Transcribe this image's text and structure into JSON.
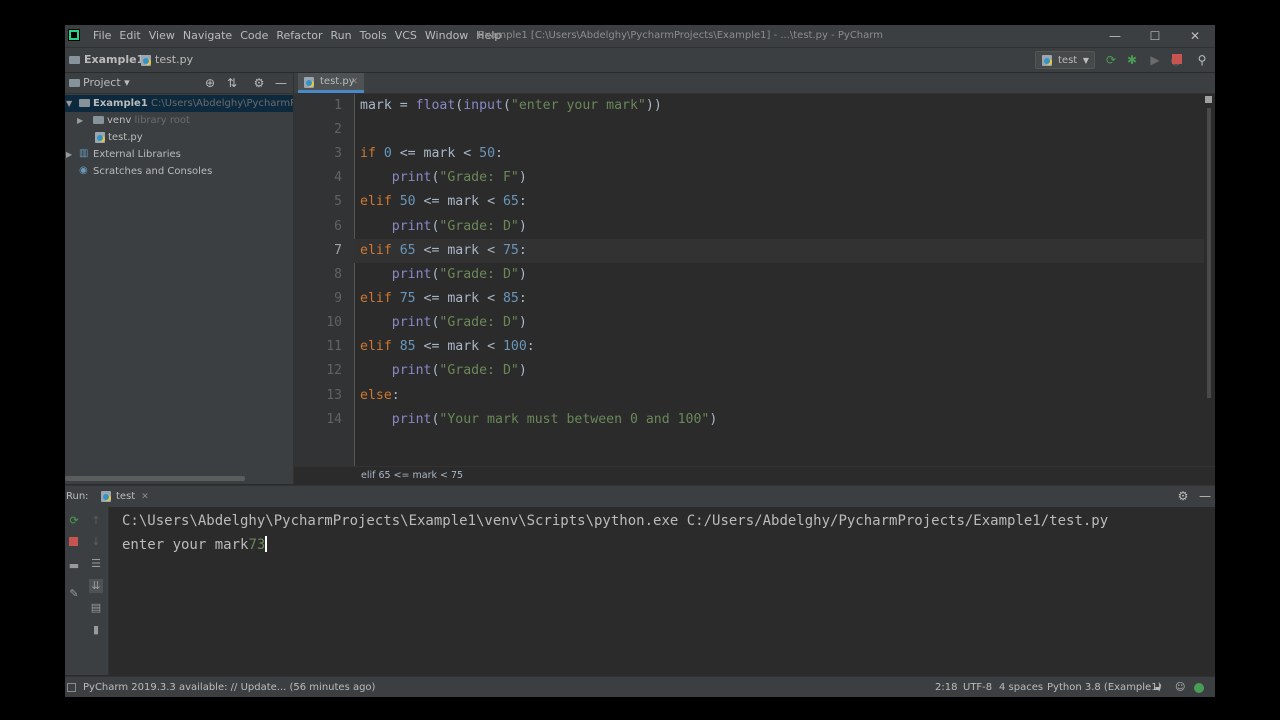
{
  "menu": [
    "File",
    "Edit",
    "View",
    "Navigate",
    "Code",
    "Refactor",
    "Run",
    "Tools",
    "VCS",
    "Window",
    "Help"
  ],
  "window_title": "Example1 [C:\\Users\\Abdelghy\\PycharmProjects\\Example1] - ...\\test.py - PyCharm",
  "window_controls": {
    "minimize": "—",
    "maximize": "☐",
    "close": "✕"
  },
  "navbar": {
    "project": "Example1",
    "file": "test.py",
    "run_config": "test"
  },
  "project_panel": {
    "title": "Project",
    "tree": [
      {
        "label": "Example1",
        "hint": "C:\\Users\\Abdelghy\\PycharmProjects\\Example1"
      },
      {
        "label": "venv",
        "hint": "library root"
      },
      {
        "label": "test.py",
        "hint": ""
      },
      {
        "label": "External Libraries",
        "hint": ""
      },
      {
        "label": "Scratches and Consoles",
        "hint": ""
      }
    ]
  },
  "editor": {
    "tab": "test.py",
    "current_line": 7,
    "line_numbers": [
      "1",
      "2",
      "3",
      "4",
      "5",
      "6",
      "7",
      "8",
      "9",
      "10",
      "11",
      "12",
      "13",
      "14"
    ],
    "code": [
      "mark = float(input(\"enter your mark\"))",
      "",
      "if 0 <= mark < 50:",
      "    print(\"Grade: F\")",
      "elif 50 <= mark < 65:",
      "    print(\"Grade: D\")",
      "elif 65 <= mark < 75:",
      "    print(\"Grade: D\")",
      "elif 75 <= mark < 85:",
      "    print(\"Grade: D\")",
      "elif 85 <= mark < 100:",
      "    print(\"Grade: D\")",
      "else:",
      "    print(\"Your mark must between 0 and 100\")"
    ],
    "breadcrumb": "elif 65 <= mark < 75"
  },
  "run_panel": {
    "label": "Run:",
    "tab": "test",
    "command": "C:\\Users\\Abdelghy\\PycharmProjects\\Example1\\venv\\Scripts\\python.exe C:/Users/Abdelghy/PycharmProjects/Example1/test.py",
    "prompt": "enter your mark",
    "input": "73"
  },
  "status_bar": {
    "message": "PyCharm 2019.3.3 available: // Update... (56 minutes ago)",
    "position": "2:18",
    "encoding": "UTF-8",
    "indent": "4 spaces",
    "interpreter": "Python 3.8 (Example1)"
  },
  "colors": {
    "keyword": "#cc7832",
    "builtin": "#8888c6",
    "number": "#6897bb",
    "string": "#6a8759",
    "run_green": "#499c54",
    "stop_red": "#c75450"
  }
}
